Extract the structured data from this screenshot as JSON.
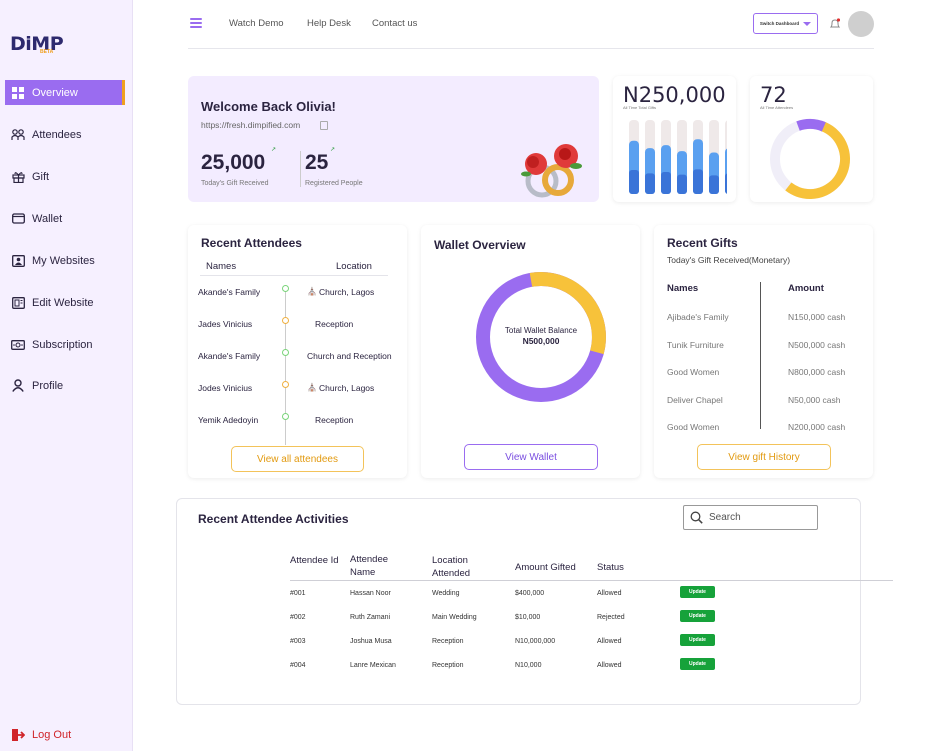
{
  "brand": {
    "logo": "DiMP",
    "sub": "BETA"
  },
  "sidebar": {
    "items": [
      {
        "label": "Overview",
        "icon": "grid-icon"
      },
      {
        "label": "Attendees",
        "icon": "people-icon"
      },
      {
        "label": "Gift",
        "icon": "gift-icon"
      },
      {
        "label": "Wallet",
        "icon": "wallet-icon"
      },
      {
        "label": "My Websites",
        "icon": "website-icon"
      },
      {
        "label": "Edit Website",
        "icon": "edit-website-icon"
      },
      {
        "label": "Subscription",
        "icon": "subscription-icon"
      },
      {
        "label": "Profile",
        "icon": "user-icon"
      }
    ],
    "logout": "Log Out"
  },
  "topnav": {
    "links": [
      "Watch Demo",
      "Help Desk",
      "Contact us"
    ],
    "switch": "Switch Dashboard"
  },
  "welcome": {
    "title": "Welcome Back Olivia!",
    "url": "https://fresh.dimpified.com",
    "gift": "25,000",
    "gift_label": "Today's Gift Received",
    "people": "25",
    "people_label": "Registered People"
  },
  "stat1": {
    "value": "N250,000",
    "label": "All Time Total Gifts",
    "bars": [
      0.72,
      0.62,
      0.66,
      0.58,
      0.74,
      0.56,
      0.62
    ]
  },
  "stat2": {
    "value": "72",
    "label": "All Time Attendees",
    "fraction": 0.55
  },
  "attendees": {
    "title": "Recent Attendees",
    "col_names": "Names",
    "col_location": "Location",
    "rows": [
      {
        "name": "Akande's Family",
        "location": "Church, Lagos",
        "dot": "green",
        "icon": true
      },
      {
        "name": "Jades Vinicius",
        "location": "Reception",
        "dot": "orange",
        "icon": false
      },
      {
        "name": "Akande's Family",
        "location": "Church and Reception",
        "dot": "green",
        "icon": false
      },
      {
        "name": "Jodes Vinicius",
        "location": "Church, Lagos",
        "dot": "orange",
        "icon": true
      },
      {
        "name": "Yemik Adedoyin",
        "location": "Reception",
        "dot": "green",
        "icon": false
      }
    ],
    "button": "View all attendees"
  },
  "wallet": {
    "title": "Wallet Overview",
    "center_label": "Total Wallet Balance",
    "center_value": "N500,000",
    "yellow_fraction": 0.32,
    "button": "View Wallet"
  },
  "gifts": {
    "title": "Recent Gifts",
    "subtitle": "Today's Gift Received(Monetary)",
    "col_names": "Names",
    "col_amount": "Amount",
    "rows": [
      {
        "name": "Ajibade's Family",
        "amount": "N150,000 cash"
      },
      {
        "name": "Tunik Furniture",
        "amount": "N500,000 cash"
      },
      {
        "name": "Good Women",
        "amount": "N800,000 cash"
      },
      {
        "name": "Deliver Chapel",
        "amount": "N50,000 cash"
      },
      {
        "name": "Good Women",
        "amount": "N200,000 cash"
      }
    ],
    "button": "View gift History"
  },
  "activity": {
    "title": "Recent Attendee Activities",
    "search_placeholder": "Search",
    "headers": [
      "Attendee Id",
      "Attendee Name",
      "Location Attended",
      "Amount Gifted",
      "Status"
    ],
    "rows": [
      {
        "id": "#001",
        "name": "Hassan Noor",
        "location": "Wedding",
        "amount": "$400,000",
        "status": "Allowed",
        "action": "Update"
      },
      {
        "id": "#002",
        "name": "Ruth Zamani",
        "location": "Main Wedding",
        "amount": "$10,000",
        "status": "Rejected",
        "action": "Update"
      },
      {
        "id": "#003",
        "name": "Joshua Musa",
        "location": "Reception",
        "amount": "N10,000,000",
        "status": "Allowed",
        "action": "Update"
      },
      {
        "id": "#004",
        "name": "Lanre Mexican",
        "location": "Reception",
        "amount": "N10,000",
        "status": "Allowed",
        "action": "Update"
      }
    ]
  },
  "colors": {
    "purple": "#9a6cf0",
    "yellow": "#f7c23a",
    "orange": "#f0a020",
    "green": "#16a23a",
    "blue": "#3f8ae8",
    "red": "#d0242a"
  }
}
